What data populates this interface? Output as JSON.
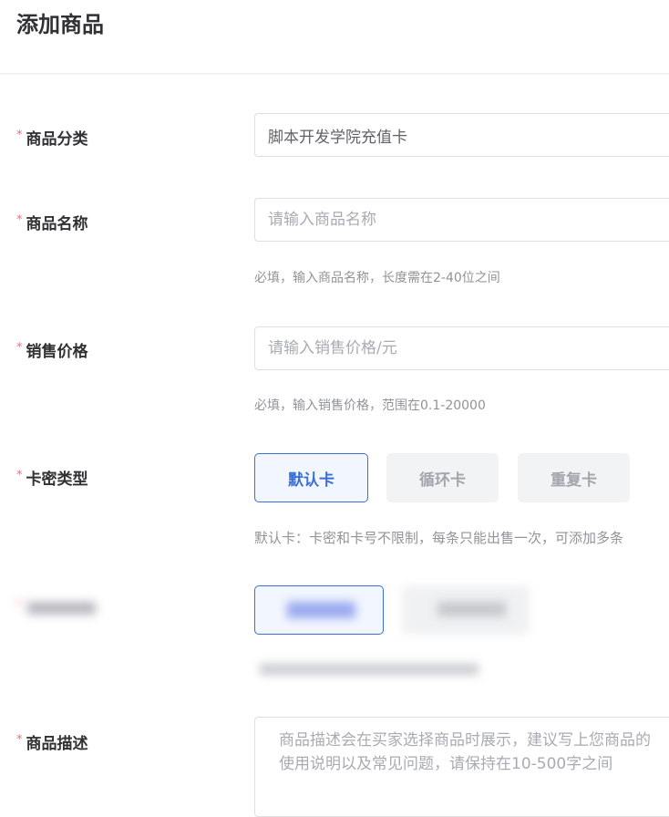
{
  "header": {
    "title": "添加商品"
  },
  "form": {
    "required_mark": "*",
    "category": {
      "label": "商品分类",
      "value": "脚本开发学院充值卡"
    },
    "name": {
      "label": "商品名称",
      "placeholder": "请输入商品名称",
      "hint": "必填，输入商品名称，长度需在2-40位之间"
    },
    "price": {
      "label": "销售价格",
      "placeholder": "请输入销售价格/元",
      "hint": "必填，输入销售价格，范围在0.1-20000"
    },
    "card_type": {
      "label": "卡密类型",
      "options": [
        "默认卡",
        "循环卡",
        "重复卡"
      ],
      "selected": "默认卡",
      "hint": "默认卡：卡密和卡号不限制，每条只能出售一次，可添加多条"
    },
    "description": {
      "label": "商品描述",
      "placeholder": "商品描述会在买家选择商品时展示，建议写上您商品的使用说明以及常见问题，请保持在10-500字之间"
    }
  },
  "colors": {
    "primary": "#3a6fd8",
    "required": "#f56c6c",
    "hint": "#909399"
  }
}
